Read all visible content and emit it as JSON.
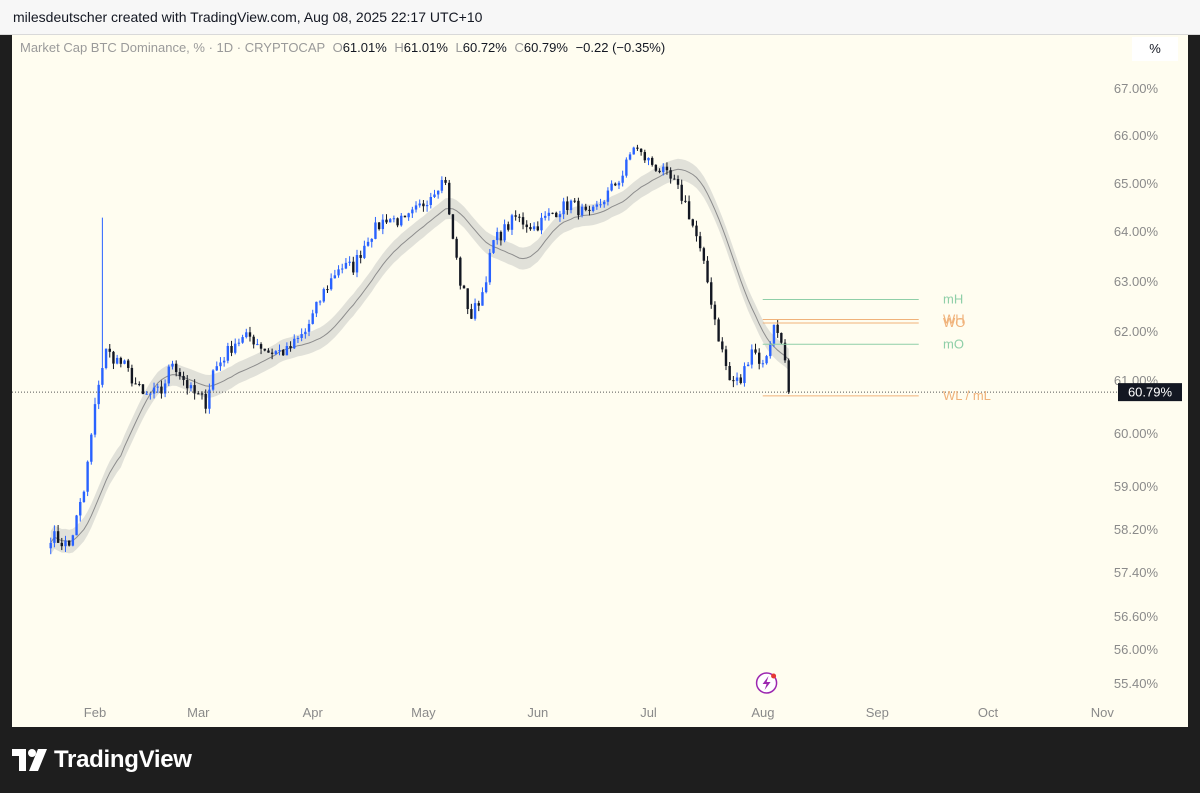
{
  "header": {
    "caption": "milesdeutscher created with TradingView.com, Aug 08, 2025 22:17 UTC+10"
  },
  "legend": {
    "title": "Market Cap BTC Dominance, %",
    "interval": "1D",
    "source": "CRYPTOCAP",
    "o_label": "O",
    "o_value": "61.01%",
    "h_label": "H",
    "h_value": "61.01%",
    "l_label": "L",
    "l_value": "60.72%",
    "c_label": "C",
    "c_value": "60.79%",
    "change": "−0.22 (−0.35%)"
  },
  "scale_button": "%",
  "brand": {
    "name": "TradingView"
  },
  "colors": {
    "up": "#2962ff",
    "down": "#131722",
    "background": "#fffdf0",
    "band": "#dcdcd5",
    "mh_line": "#8fcfa8",
    "wo_line": "#f0b27a"
  },
  "chart_data": {
    "type": "candlestick",
    "symbol": "Market Cap BTC Dominance, %",
    "y_unit": "%",
    "y_ticks": [
      "67.00%",
      "66.00%",
      "65.00%",
      "64.00%",
      "63.00%",
      "62.00%",
      "61.00%",
      "60.00%",
      "59.00%",
      "58.20%",
      "57.40%",
      "56.60%",
      "56.00%",
      "55.40%"
    ],
    "x_ticks": [
      "Feb",
      "Mar",
      "Apr",
      "May",
      "Jun",
      "Jul",
      "Aug",
      "Sep",
      "Oct",
      "Nov"
    ],
    "last_price": "60.79%",
    "last_value": 60.79,
    "levels": [
      {
        "label": "mH",
        "value": 62.65,
        "color": "#8fcfa8"
      },
      {
        "label": "WH",
        "value": 62.25,
        "color": "#f0b27a"
      },
      {
        "label": "WO",
        "value": 62.18,
        "color": "#f0b27a"
      },
      {
        "label": "mO",
        "value": 61.75,
        "color": "#8fcfa8"
      },
      {
        "label": "WL / mL",
        "value": 60.72,
        "color": "#f0b27a"
      }
    ],
    "price_path": [
      [
        "2025-01-20",
        58.1
      ],
      [
        "2025-01-25",
        57.9
      ],
      [
        "2025-01-29",
        58.9
      ],
      [
        "2025-02-02",
        61.0
      ],
      [
        "2025-02-04",
        61.6
      ],
      [
        "2025-02-09",
        61.3
      ],
      [
        "2025-02-14",
        60.7
      ],
      [
        "2025-02-19",
        60.8
      ],
      [
        "2025-02-22",
        61.4
      ],
      [
        "2025-02-27",
        60.8
      ],
      [
        "2025-03-03",
        60.6
      ],
      [
        "2025-03-05",
        61.2
      ],
      [
        "2025-03-11",
        61.8
      ],
      [
        "2025-03-15",
        61.9
      ],
      [
        "2025-03-20",
        61.6
      ],
      [
        "2025-03-25",
        61.6
      ],
      [
        "2025-03-30",
        62.0
      ],
      [
        "2025-04-04",
        62.8
      ],
      [
        "2025-04-08",
        63.3
      ],
      [
        "2025-04-12",
        63.3
      ],
      [
        "2025-04-16",
        63.9
      ],
      [
        "2025-04-21",
        64.3
      ],
      [
        "2025-04-26",
        64.2
      ],
      [
        "2025-05-01",
        64.6
      ],
      [
        "2025-05-05",
        65.0
      ],
      [
        "2025-05-07",
        65.1
      ],
      [
        "2025-05-08",
        64.3
      ],
      [
        "2025-05-11",
        63.0
      ],
      [
        "2025-05-14",
        62.3
      ],
      [
        "2025-05-17",
        62.8
      ],
      [
        "2025-05-20",
        63.8
      ],
      [
        "2025-05-26",
        64.3
      ],
      [
        "2025-05-31",
        64.1
      ],
      [
        "2025-06-05",
        64.4
      ],
      [
        "2025-06-10",
        64.6
      ],
      [
        "2025-06-15",
        64.3
      ],
      [
        "2025-06-19",
        64.7
      ],
      [
        "2025-06-24",
        65.2
      ],
      [
        "2025-06-27",
        65.8
      ],
      [
        "2025-06-29",
        65.6
      ],
      [
        "2025-07-04",
        65.3
      ],
      [
        "2025-07-08",
        65.0
      ],
      [
        "2025-07-11",
        64.6
      ],
      [
        "2025-07-14",
        63.9
      ],
      [
        "2025-07-17",
        63.0
      ],
      [
        "2025-07-20",
        61.9
      ],
      [
        "2025-07-23",
        61.0
      ],
      [
        "2025-07-26",
        61.0
      ],
      [
        "2025-07-29",
        61.7
      ],
      [
        "2025-08-01",
        61.3
      ],
      [
        "2025-08-04",
        62.1
      ],
      [
        "2025-08-06",
        61.9
      ],
      [
        "2025-08-08",
        60.79
      ]
    ],
    "spike": {
      "date": "2025-02-03",
      "high": 64.3
    },
    "marker": {
      "date": "2025-08-02",
      "icon": "lightning-icon"
    }
  }
}
